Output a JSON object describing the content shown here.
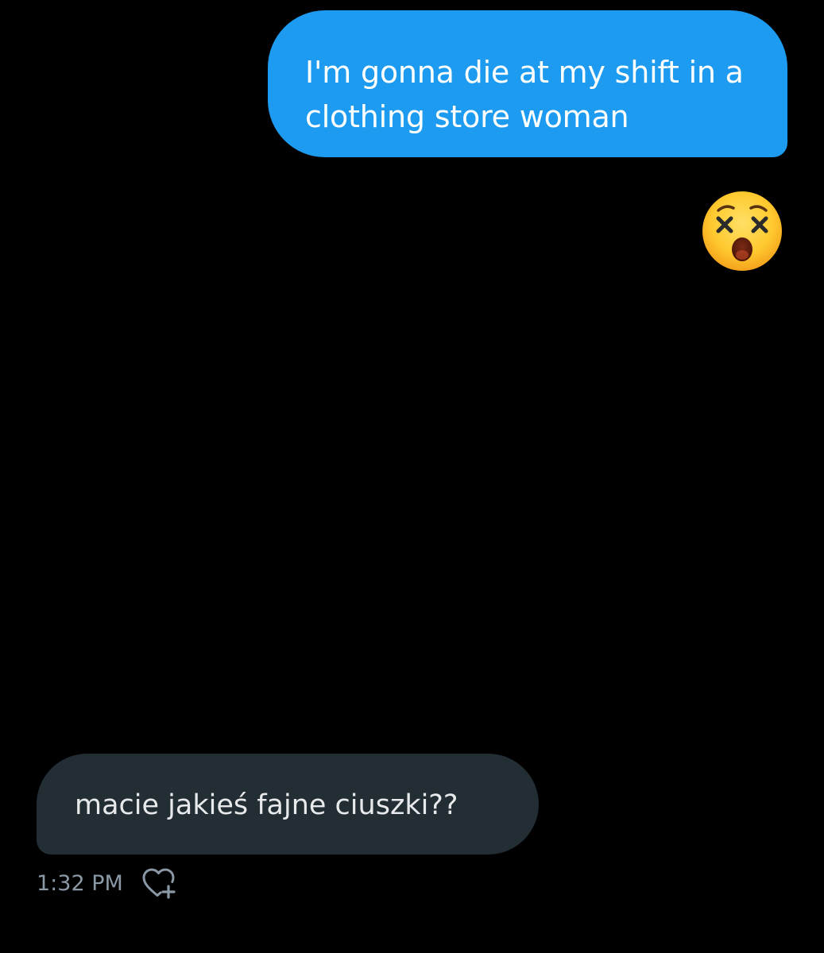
{
  "messages": {
    "outgoing": {
      "text": "I'm gonna die at my shift in a clothing store woman",
      "bubble_color": "#1d9bf0",
      "text_color": "#ffffff"
    },
    "outgoing_emoji": {
      "icon": "dizzy-face-emoji"
    },
    "incoming": {
      "text": "macie jakieś fajne ciuszki??",
      "bubble_color": "#222d34",
      "text_color": "#e7e9ea",
      "timestamp": "1:32 PM",
      "reaction_icon": "heart-plus-icon"
    }
  },
  "colors": {
    "background": "#000000",
    "timestamp": "#8b98a5"
  }
}
